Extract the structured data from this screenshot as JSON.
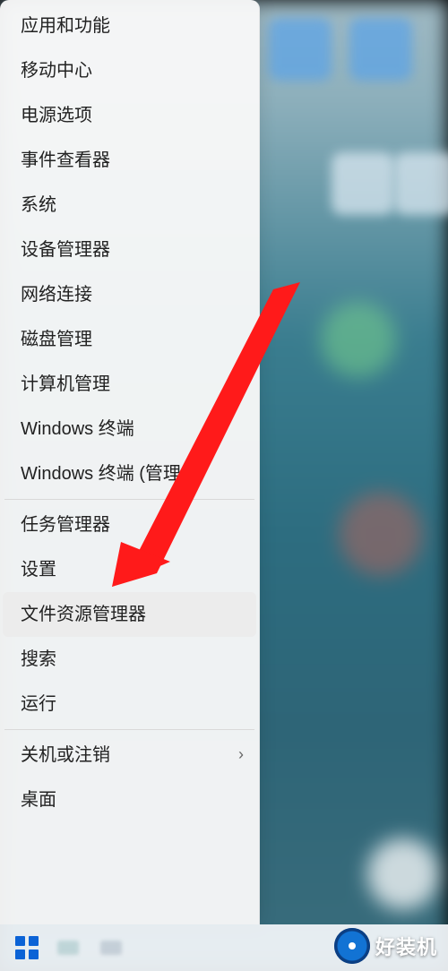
{
  "menu": {
    "items": [
      {
        "label": "应用和功能"
      },
      {
        "label": "移动中心"
      },
      {
        "label": "电源选项"
      },
      {
        "label": "事件查看器"
      },
      {
        "label": "系统"
      },
      {
        "label": "设备管理器"
      },
      {
        "label": "网络连接"
      },
      {
        "label": "磁盘管理"
      },
      {
        "label": "计算机管理"
      },
      {
        "label": "Windows 终端"
      },
      {
        "label": "Windows 终端 (管理员)"
      }
    ],
    "sep1": true,
    "items2": [
      {
        "label": "任务管理器"
      },
      {
        "label": "设置"
      },
      {
        "label": "文件资源管理器",
        "hovered": true
      },
      {
        "label": "搜索"
      },
      {
        "label": "运行"
      }
    ],
    "sep2": true,
    "items3": [
      {
        "label": "关机或注销",
        "submenu": true
      },
      {
        "label": "桌面"
      }
    ]
  },
  "watermark": {
    "text": "好装机"
  }
}
